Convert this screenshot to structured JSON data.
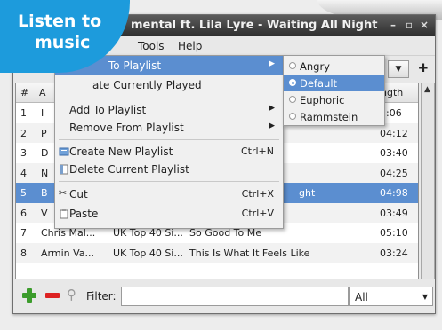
{
  "badge": {
    "line1": "Listen to",
    "line2": "music"
  },
  "window": {
    "title": "mental ft. Lila Lyre - Waiting All Night",
    "controls": {
      "minimize": "–",
      "maximize": "▫",
      "close": "×"
    }
  },
  "menubar": [
    {
      "label": "Tools"
    },
    {
      "label": "Help"
    }
  ],
  "table": {
    "headers": {
      "num": "#",
      "artist": "A",
      "length": "ngth"
    },
    "rows": [
      {
        "num": "1",
        "artist": "I",
        "album": "",
        "title": "",
        "length": "1:06"
      },
      {
        "num": "2",
        "artist": "P",
        "album": "",
        "title": "",
        "length": "04:12"
      },
      {
        "num": "3",
        "artist": "D",
        "album": "",
        "title": "",
        "length": "03:40"
      },
      {
        "num": "4",
        "artist": "N",
        "album": "",
        "title": "",
        "length": "04:25"
      },
      {
        "num": "5",
        "artist": "B",
        "album": "",
        "title": "ght",
        "length": "04:98"
      },
      {
        "num": "6",
        "artist": "V",
        "album": "",
        "title": "",
        "length": "03:49"
      },
      {
        "num": "7",
        "artist": "Chris Mal...",
        "album": "UK Top 40 Si...",
        "title": "So Good To Me",
        "length": "05:10"
      },
      {
        "num": "8",
        "artist": "Armin Va...",
        "album": "UK Top 40 Si...",
        "title": "This Is What It Feels Like",
        "length": "03:24"
      }
    ]
  },
  "context_menu": {
    "items": [
      {
        "label": "To Playlist",
        "submenu": true,
        "highlighted": true
      },
      {
        "label": "ate Currently Played"
      },
      {
        "label": "Add To Playlist",
        "submenu": true
      },
      {
        "label": "Remove From Playlist",
        "submenu": true
      },
      {
        "label": "Create New Playlist",
        "accel": "Ctrl+N",
        "icon": "new-playlist-icon"
      },
      {
        "label": "Delete Current Playlist",
        "icon": "delete-playlist-icon"
      },
      {
        "label": "Cut",
        "accel": "Ctrl+X",
        "icon": "scissors-icon"
      },
      {
        "label": "Paste",
        "accel": "Ctrl+V",
        "icon": "clipboard-icon"
      }
    ]
  },
  "submenu": {
    "options": [
      {
        "label": "Angry",
        "selected": false
      },
      {
        "label": "Default",
        "selected": true
      },
      {
        "label": "Euphoric",
        "selected": false
      },
      {
        "label": "Rammstein",
        "selected": false
      }
    ]
  },
  "filterbar": {
    "label": "Filter:",
    "value": "",
    "scope": "All"
  },
  "colors": {
    "accent": "#5b8ed0",
    "badge": "#1d9bdc"
  }
}
